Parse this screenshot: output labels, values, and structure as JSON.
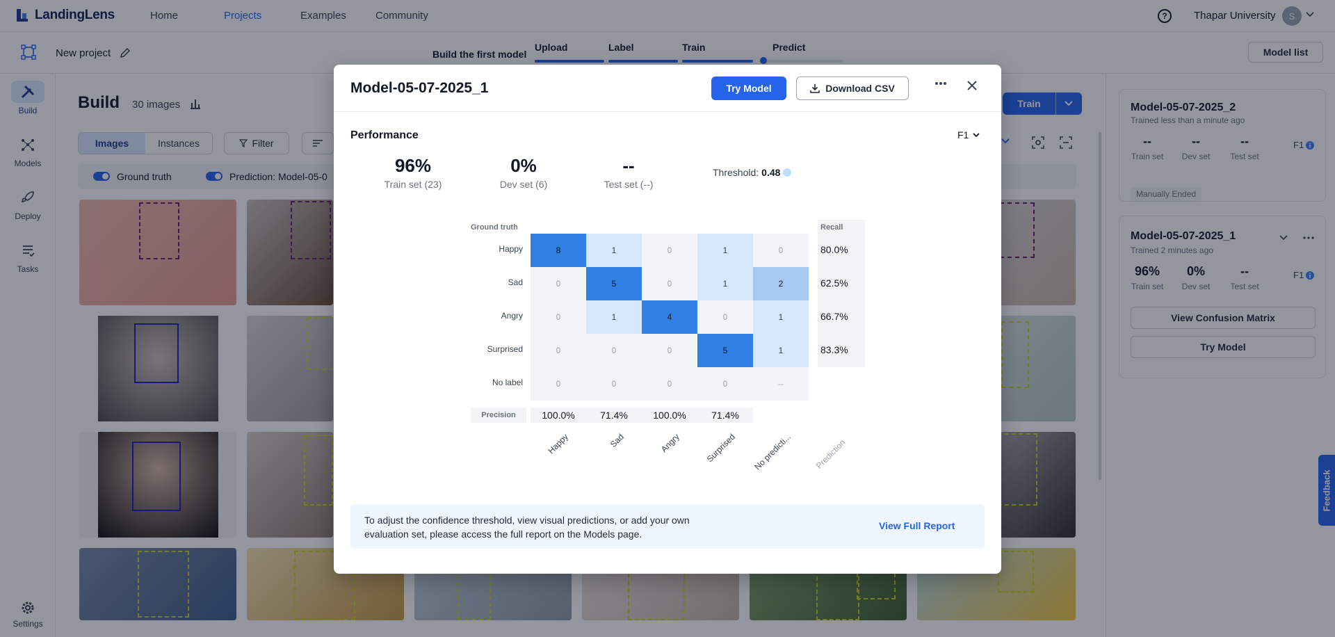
{
  "app": {
    "name": "LandingLens"
  },
  "nav": {
    "items": [
      "Home",
      "Projects",
      "Examples",
      "Community"
    ],
    "active": "Projects"
  },
  "user": {
    "org": "Thapar University",
    "initial": "S"
  },
  "project": {
    "name": "New project",
    "steps_title": "Build the first model",
    "steps": [
      "Upload",
      "Label",
      "Train",
      "Predict"
    ],
    "model_list_label": "Model list"
  },
  "sidebar": {
    "items": [
      "Build",
      "Models",
      "Deploy",
      "Tasks"
    ],
    "settings": "Settings"
  },
  "build": {
    "title": "Build",
    "image_count": "30 images",
    "tabs": [
      "Images",
      "Instances"
    ],
    "filter_label": "Filter",
    "ground_truth_label": "Ground truth",
    "prediction_label": "Prediction: Model-05-0",
    "train_label": "Train"
  },
  "models_panel": {
    "cards": [
      {
        "name": "Model-05-07-2025_2",
        "trained": "Trained less than a minute ago",
        "train": "--",
        "dev": "--",
        "test": "--",
        "metric": "F1",
        "badge": "Manually Ended"
      },
      {
        "name": "Model-05-07-2025_1",
        "trained": "Trained 2 minutes ago",
        "train": "96%",
        "dev": "0%",
        "test": "--",
        "metric": "F1",
        "btn_matrix": "View Confusion Matrix",
        "btn_try": "Try Model"
      }
    ],
    "labels": {
      "train": "Train set",
      "dev": "Dev set",
      "test": "Test set"
    }
  },
  "feedback": {
    "label": "Feedback"
  },
  "modal": {
    "title": "Model-05-07-2025_1",
    "try_label": "Try Model",
    "csv_label": "Download CSV",
    "performance_label": "Performance",
    "metric": "F1",
    "stats": [
      {
        "value": "96%",
        "label": "Train set (23)"
      },
      {
        "value": "0%",
        "label": "Dev set (6)"
      },
      {
        "value": "--",
        "label": "Test set (--)"
      }
    ],
    "threshold_label": "Threshold:",
    "threshold_value": "0.48",
    "matrix": {
      "ground_truth_label": "Ground truth",
      "recall_label": "Recall",
      "precision_label": "Precision",
      "prediction_label": "Prediction",
      "rows": [
        "Happy",
        "Sad",
        "Angry",
        "Surprised",
        "No label"
      ],
      "cols": [
        "Happy",
        "Sad",
        "Angry",
        "Surprised",
        "No predicti..."
      ],
      "values": [
        [
          "8",
          "1",
          "0",
          "1",
          "0"
        ],
        [
          "0",
          "5",
          "0",
          "1",
          "2"
        ],
        [
          "0",
          "1",
          "4",
          "0",
          "1"
        ],
        [
          "0",
          "0",
          "0",
          "5",
          "1"
        ],
        [
          "0",
          "0",
          "0",
          "0",
          "--"
        ]
      ],
      "recall": [
        "80.0%",
        "62.5%",
        "66.7%",
        "83.3%"
      ],
      "precision": [
        "100.0%",
        "71.4%",
        "100.0%",
        "71.4%"
      ]
    },
    "note": "To adjust the confidence threshold, view visual predictions, or add your own evaluation set, please access the full report on the Models page.",
    "report_label": "View Full Report"
  },
  "colors": {
    "accent": "#2563eb",
    "cell_high": "#2f80e2",
    "cell_mid": "#a6c9f3",
    "cell_low": "#d6e6fb",
    "box_blue": "#1d1db5",
    "box_purple": "#6b1a6b",
    "box_yellow": "#c8d41f"
  }
}
